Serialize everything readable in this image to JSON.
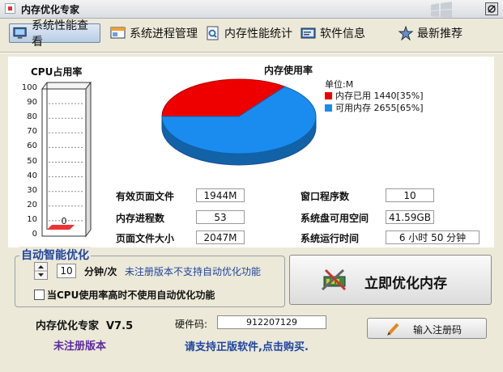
{
  "window": {
    "title": "内存优化专家"
  },
  "toolbar": {
    "tabs": [
      {
        "label": "系统性能查看",
        "icon": "monitor-icon",
        "active": true
      },
      {
        "label": "系统进程管理",
        "icon": "window-icon"
      },
      {
        "label": "内存性能统计",
        "icon": "document-icon"
      },
      {
        "label": "软件信息",
        "icon": "info-icon"
      },
      {
        "label": "最新推荐",
        "icon": "star-icon"
      }
    ]
  },
  "cpu": {
    "title": "CPU占用率",
    "ticks": [
      "100",
      "90",
      "80",
      "70",
      "60",
      "50",
      "40",
      "30",
      "20",
      "10",
      "0"
    ],
    "value_label": "0",
    "usage_percent": 0
  },
  "memory_chart": {
    "title": "内存使用率",
    "unit": "单位:M",
    "legend": [
      {
        "label": "内存已用 1440[35%]",
        "color": "#ee0000"
      },
      {
        "label": "可用内存 2655[65%]",
        "color": "#1a8cf0"
      }
    ]
  },
  "chart_data": {
    "type": "pie",
    "title": "内存使用率",
    "categories": [
      "内存已用",
      "可用内存"
    ],
    "values": [
      1440,
      2655
    ],
    "percentages": [
      35,
      65
    ],
    "unit": "单位:M",
    "colors": [
      "#ee0000",
      "#1a8cf0"
    ],
    "legend_position": "right"
  },
  "stats": {
    "effective_pagefile_label": "有效页面文件",
    "effective_pagefile_value": "1944M",
    "process_count_label": "内存进程数",
    "process_count_value": "53",
    "pagefile_size_label": "页面文件大小",
    "pagefile_size_value": "2047M",
    "window_count_label": "窗口程序数",
    "window_count_value": "10",
    "disk_free_label": "系统盘可用空间",
    "disk_free_value": "41.59GB",
    "uptime_label": "系统运行时间",
    "uptime_value": "6 小时 50 分钟"
  },
  "auto_optimize": {
    "title": "自动智能优化",
    "interval_value": "10",
    "interval_unit": "分钟/次",
    "notice": "未注册版本不支持自动优化功能",
    "cpu_checkbox_label": "当CPU使用率高时不使用自动优化功能",
    "cpu_checkbox_checked": false
  },
  "optimize_button": {
    "label": "立即优化内存"
  },
  "footer": {
    "product": "内存优化专家  V7.5",
    "unregistered": "未注册版本",
    "hardware_label": "硬件码:",
    "hardware_code": "912207129",
    "support_text": "请支持正版软件,点击购买.",
    "register_button": "输入注册码"
  }
}
